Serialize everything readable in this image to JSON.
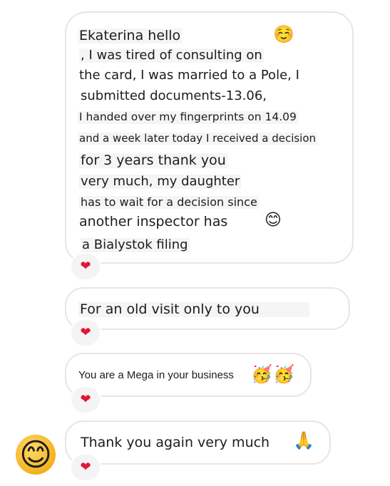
{
  "messages": [
    {
      "lines": [
        "Ekaterina hello",
        ", I was tired of consulting on",
        "the card, I was married to a Pole, I",
        "submitted documents-13.06,",
        "I handed over my fingerprints on 14.09",
        "and a week later today I received a decision",
        "for 3 years thank you",
        "very much, my daughter",
        "has to wait for a decision since",
        "another inspector has",
        "a Bialystok filing"
      ],
      "emojis": [
        "☺️",
        "😊"
      ],
      "reaction": "❤"
    },
    {
      "text": "For an old visit only to you",
      "reaction": "❤"
    },
    {
      "text": "You are a Mega in your business",
      "emojis": [
        "🥳",
        "🥳"
      ],
      "reaction": "❤"
    },
    {
      "text": "Thank you again very much",
      "emojis": [
        "🙏"
      ],
      "reaction": "❤"
    }
  ],
  "sender_avatar": "😊",
  "icons": {
    "reaction": "heart-icon",
    "avatar": "smiling-face-icon"
  },
  "colors": {
    "bubble_border": "#e6e6e6",
    "heart": "#e0163a"
  }
}
